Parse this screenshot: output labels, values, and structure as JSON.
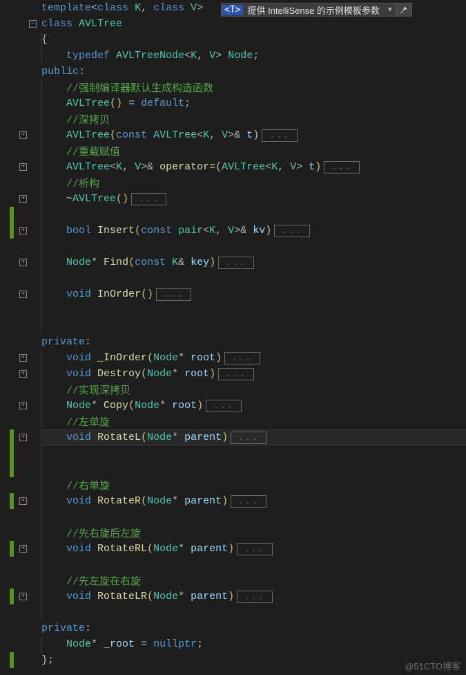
{
  "tooltip": {
    "tparam": "<T>",
    "text": "提供 IntelliSense 的示例模板参数",
    "arrow": "▼"
  },
  "fold_dots": "...",
  "watermark": "@51CTO博客",
  "code": {
    "template": "template",
    "class_kw": "class",
    "K": "K",
    "V": "V",
    "AVLTree": "AVLTree",
    "open_brace": "{",
    "close_brace": "}",
    "typedef": "typedef",
    "AVLTreeNode": "AVLTreeNode",
    "Node": "Node",
    "public": "public",
    "private": "private",
    "colon": ":",
    "semicolon": ";",
    "c_ctor": "//强制编译器默认生成构造函数",
    "ctor_def": "AVLTree",
    "parens": "()",
    "eq": " = ",
    "default": "default",
    "c_deep": "//深拷贝",
    "const": "const",
    "amp": "&",
    "t": " t",
    "c_assign": "//重载赋值",
    "operator_eq": " operator=",
    "c_dtor": "//析构",
    "tilde": "~",
    "bool": "bool",
    "Insert": " Insert",
    "pair": "pair",
    "kv": " kv",
    "Find": " Find",
    "key": " key",
    "void": "void",
    "InOrder": " InOrder",
    "uInOrder": " _InOrder",
    "root": " root",
    "Destroy": " Destroy",
    "c_deep2": "//实现深拷贝",
    "Copy": " Copy",
    "c_rotL": "//左单旋",
    "RotateL": " RotateL",
    "parent": " parent",
    "c_rotR": "//右单旋",
    "RotateR": " RotateR",
    "c_rotRL": "//先右旋后左旋",
    "RotateRL": " RotateRL",
    "c_rotLR": "//先左旋在右旋",
    "RotateLR": " RotateLR",
    "uroot": " _root",
    "nullptr": "nullptr",
    "star": "*",
    "comma": ","
  }
}
